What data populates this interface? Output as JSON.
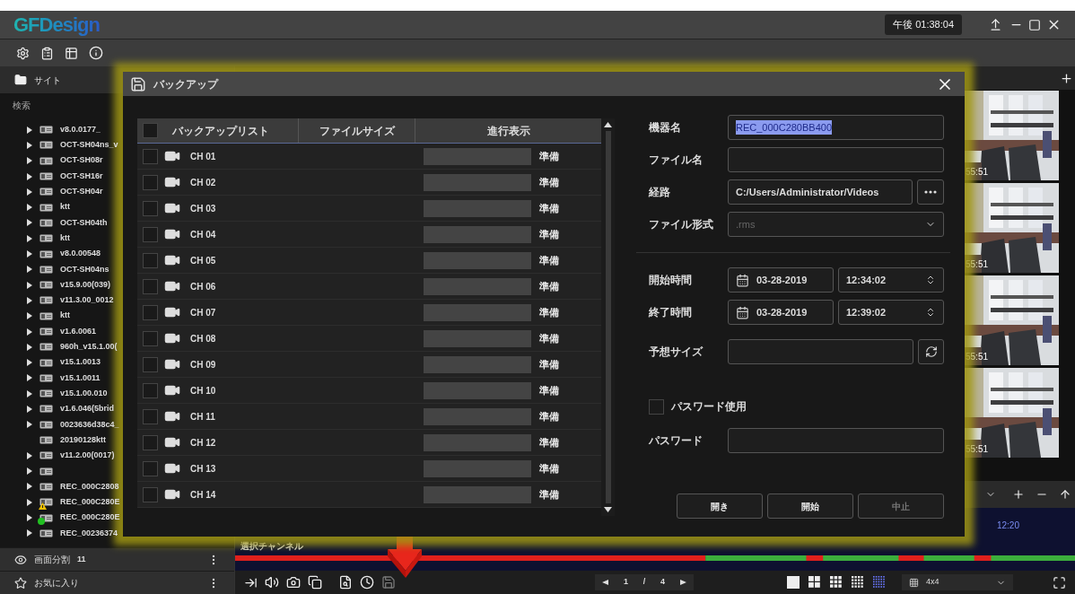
{
  "app": {
    "logo": "GFDesign",
    "clock": "午後 01:38:04"
  },
  "sidebar": {
    "header": "サイト",
    "search_label": "検索",
    "tree": [
      {
        "label": "v8.0.0177_",
        "expandable": true
      },
      {
        "label": "OCT-SH04ns_v",
        "expandable": true
      },
      {
        "label": "OCT-SH08r",
        "expandable": true
      },
      {
        "label": "OCT-SH16r",
        "expandable": true
      },
      {
        "label": "OCT-SH04r",
        "expandable": true
      },
      {
        "label": "ktt",
        "expandable": true
      },
      {
        "label": "OCT-SH04th",
        "expandable": true
      },
      {
        "label": "ktt",
        "expandable": true
      },
      {
        "label": "v8.0.00548",
        "expandable": true
      },
      {
        "label": "OCT-SH04ns",
        "expandable": true
      },
      {
        "label": "v15.9.00(039)",
        "expandable": true
      },
      {
        "label": "v11.3.00_0012",
        "expandable": true
      },
      {
        "label": "ktt",
        "expandable": true
      },
      {
        "label": "v1.6.0061",
        "expandable": true
      },
      {
        "label": "960h_v15.1.00(",
        "expandable": true
      },
      {
        "label": "v15.1.0013",
        "expandable": true
      },
      {
        "label": "v15.1.0011",
        "expandable": true
      },
      {
        "label": "v15.1.00.010",
        "expandable": true
      },
      {
        "label": "v1.6.046(5brid",
        "expandable": true
      },
      {
        "label": "0023636d38c4_",
        "expandable": true
      },
      {
        "label": "20190128ktt",
        "expandable": false
      },
      {
        "label": "v11.2.00(0017)",
        "expandable": true
      },
      {
        "expandable": true
      },
      {
        "label": "REC_000C2808",
        "expandable": true
      },
      {
        "label": "REC_000C280E",
        "expandable": true,
        "kind": "warning"
      },
      {
        "label": "REC_000C280E",
        "expandable": true,
        "kind": "online"
      },
      {
        "label": "REC_00236374",
        "expandable": true
      }
    ],
    "panels": [
      {
        "kind": "split",
        "label": "画面分割",
        "count": "11"
      },
      {
        "kind": "favorites",
        "label": "お気に入り"
      }
    ]
  },
  "video": {
    "thumbnails": [
      {
        "timestamp": "55:51"
      },
      {
        "timestamp": "55:51"
      },
      {
        "timestamp": "55:51"
      },
      {
        "timestamp": "55:51"
      }
    ],
    "ruler_label": "12:20",
    "channel_label": "選択チャンネル",
    "page": {
      "current": "1",
      "separator": "/",
      "total": "4"
    },
    "layouts": [
      {
        "selected": false
      },
      {
        "selected": false
      },
      {
        "selected": false
      },
      {
        "selected": false
      },
      {
        "selected": true
      }
    ],
    "layout_value": "4x4"
  },
  "dialog": {
    "title": "バックアップ",
    "table": {
      "header_checked": false,
      "columns": [
        "バックアップリスト",
        "ファイルサイズ",
        "進行表示"
      ],
      "rows": [
        {
          "name": "CH 01",
          "checked": false,
          "level": 0,
          "status": "準備"
        },
        {
          "name": "CH 02",
          "checked": false,
          "level": 0,
          "status": "準備"
        },
        {
          "name": "CH 03",
          "checked": false,
          "level": 0,
          "status": "準備"
        },
        {
          "name": "CH 04",
          "checked": false,
          "level": 0,
          "status": "準備"
        },
        {
          "name": "CH 05",
          "checked": false,
          "level": 0,
          "status": "準備"
        },
        {
          "name": "CH 06",
          "checked": false,
          "level": 0,
          "status": "準備"
        },
        {
          "name": "CH 07",
          "checked": false,
          "level": 0,
          "status": "準備"
        },
        {
          "name": "CH 08",
          "checked": false,
          "level": 0,
          "status": "準備"
        },
        {
          "name": "CH 09",
          "checked": false,
          "level": 0,
          "status": "準備"
        },
        {
          "name": "CH 10",
          "checked": false,
          "level": 0,
          "status": "準備"
        },
        {
          "name": "CH 11",
          "checked": false,
          "level": 0,
          "status": "準備"
        },
        {
          "name": "CH 12",
          "checked": false,
          "level": 0,
          "status": "準備"
        },
        {
          "name": "CH 13",
          "checked": false,
          "level": 0,
          "status": "準備"
        },
        {
          "name": "CH 14",
          "checked": false,
          "level": 0,
          "status": "準備"
        }
      ]
    },
    "form": {
      "device_name": {
        "label": "機器名",
        "value": "REC_000C280BB400"
      },
      "file_name": {
        "label": "ファイル名"
      },
      "path": {
        "label": "経路",
        "value": "C:/Users/Administrator/Videos"
      },
      "format": {
        "label": "ファイル形式",
        "value": ".rms",
        "disabled": true
      },
      "start": {
        "label": "開始時間",
        "date": "03-28-2019",
        "time": "12:34:02"
      },
      "end": {
        "label": "終了時間",
        "date": "03-28-2019",
        "time": "12:39:02"
      },
      "size": {
        "label": "予想サイズ"
      },
      "use_password": {
        "label": "パスワード使用",
        "checked": false
      },
      "password": {
        "label": "パスワード"
      }
    },
    "buttons": [
      {
        "label": "開き",
        "disabled": false
      },
      {
        "label": "開始",
        "disabled": false
      },
      {
        "label": "中止",
        "disabled": true
      }
    ]
  }
}
